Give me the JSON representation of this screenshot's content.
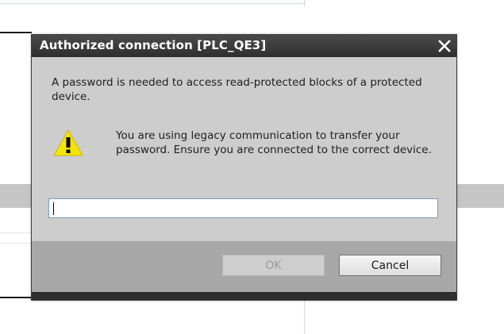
{
  "dialog": {
    "title": "Authorized connection [PLC_QE3]",
    "message": "A password is needed to access read-protected blocks of a protected device.",
    "warning": "You are using legacy communication to transfer your password. Ensure you are connected to the correct device.",
    "password_value": "",
    "ok_label": "OK",
    "cancel_label": "Cancel",
    "ok_enabled": false
  },
  "icons": {
    "close": "close-icon",
    "warning": "warning-icon"
  },
  "colors": {
    "titlebar": "#3a3a3a",
    "dialog_body": "#cdcdcd",
    "footer": "#a8a8a8",
    "warning_yellow": "#f5e400"
  }
}
